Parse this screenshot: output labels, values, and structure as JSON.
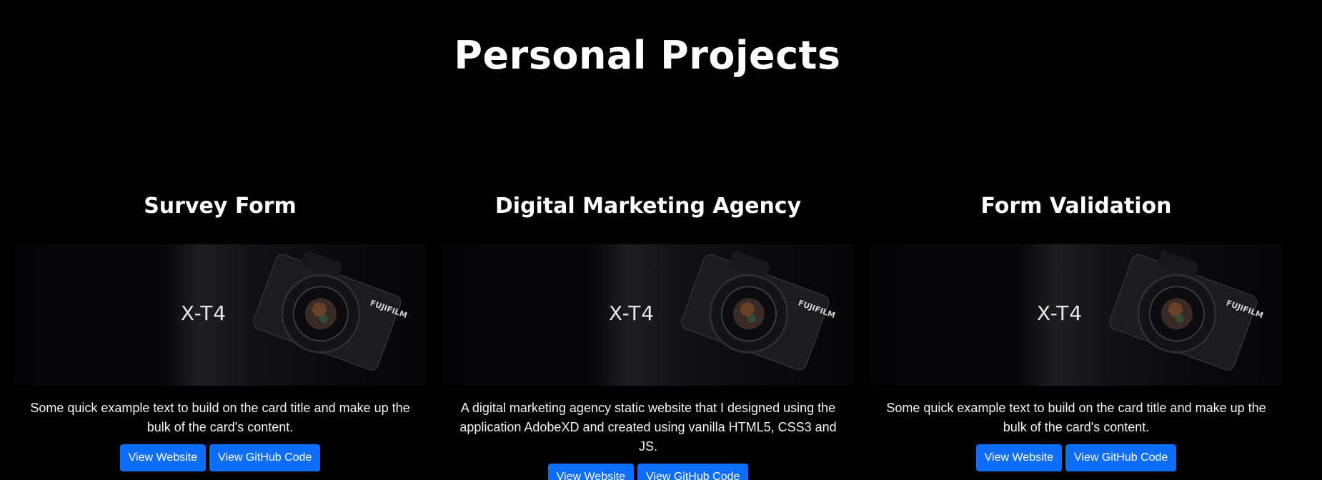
{
  "page": {
    "title": "Personal Projects"
  },
  "colors": {
    "background": "#000000",
    "button": "#0d6efd",
    "text": "#ffffff"
  },
  "cards": [
    {
      "title": "Survey Form",
      "image_text": "X-T4",
      "image_brand": "FUJIFILM",
      "description": "Some quick example text to build on the card title and make up the bulk of the card's content.",
      "website_label": "View Website",
      "github_label": "View GitHub Code"
    },
    {
      "title": "Digital Marketing Agency",
      "image_text": "X-T4",
      "image_brand": "FUJIFILM",
      "description": "A digital marketing agency static website that I designed using the application AdobeXD and created using vanilla HTML5, CSS3 and JS.",
      "website_label": "View Website",
      "github_label": "View GitHub Code"
    },
    {
      "title": "Form Validation",
      "image_text": "X-T4",
      "image_brand": "FUJIFILM",
      "description": "Some quick example text to build on the card title and make up the bulk of the card's content.",
      "website_label": "View Website",
      "github_label": "View GitHub Code"
    }
  ]
}
